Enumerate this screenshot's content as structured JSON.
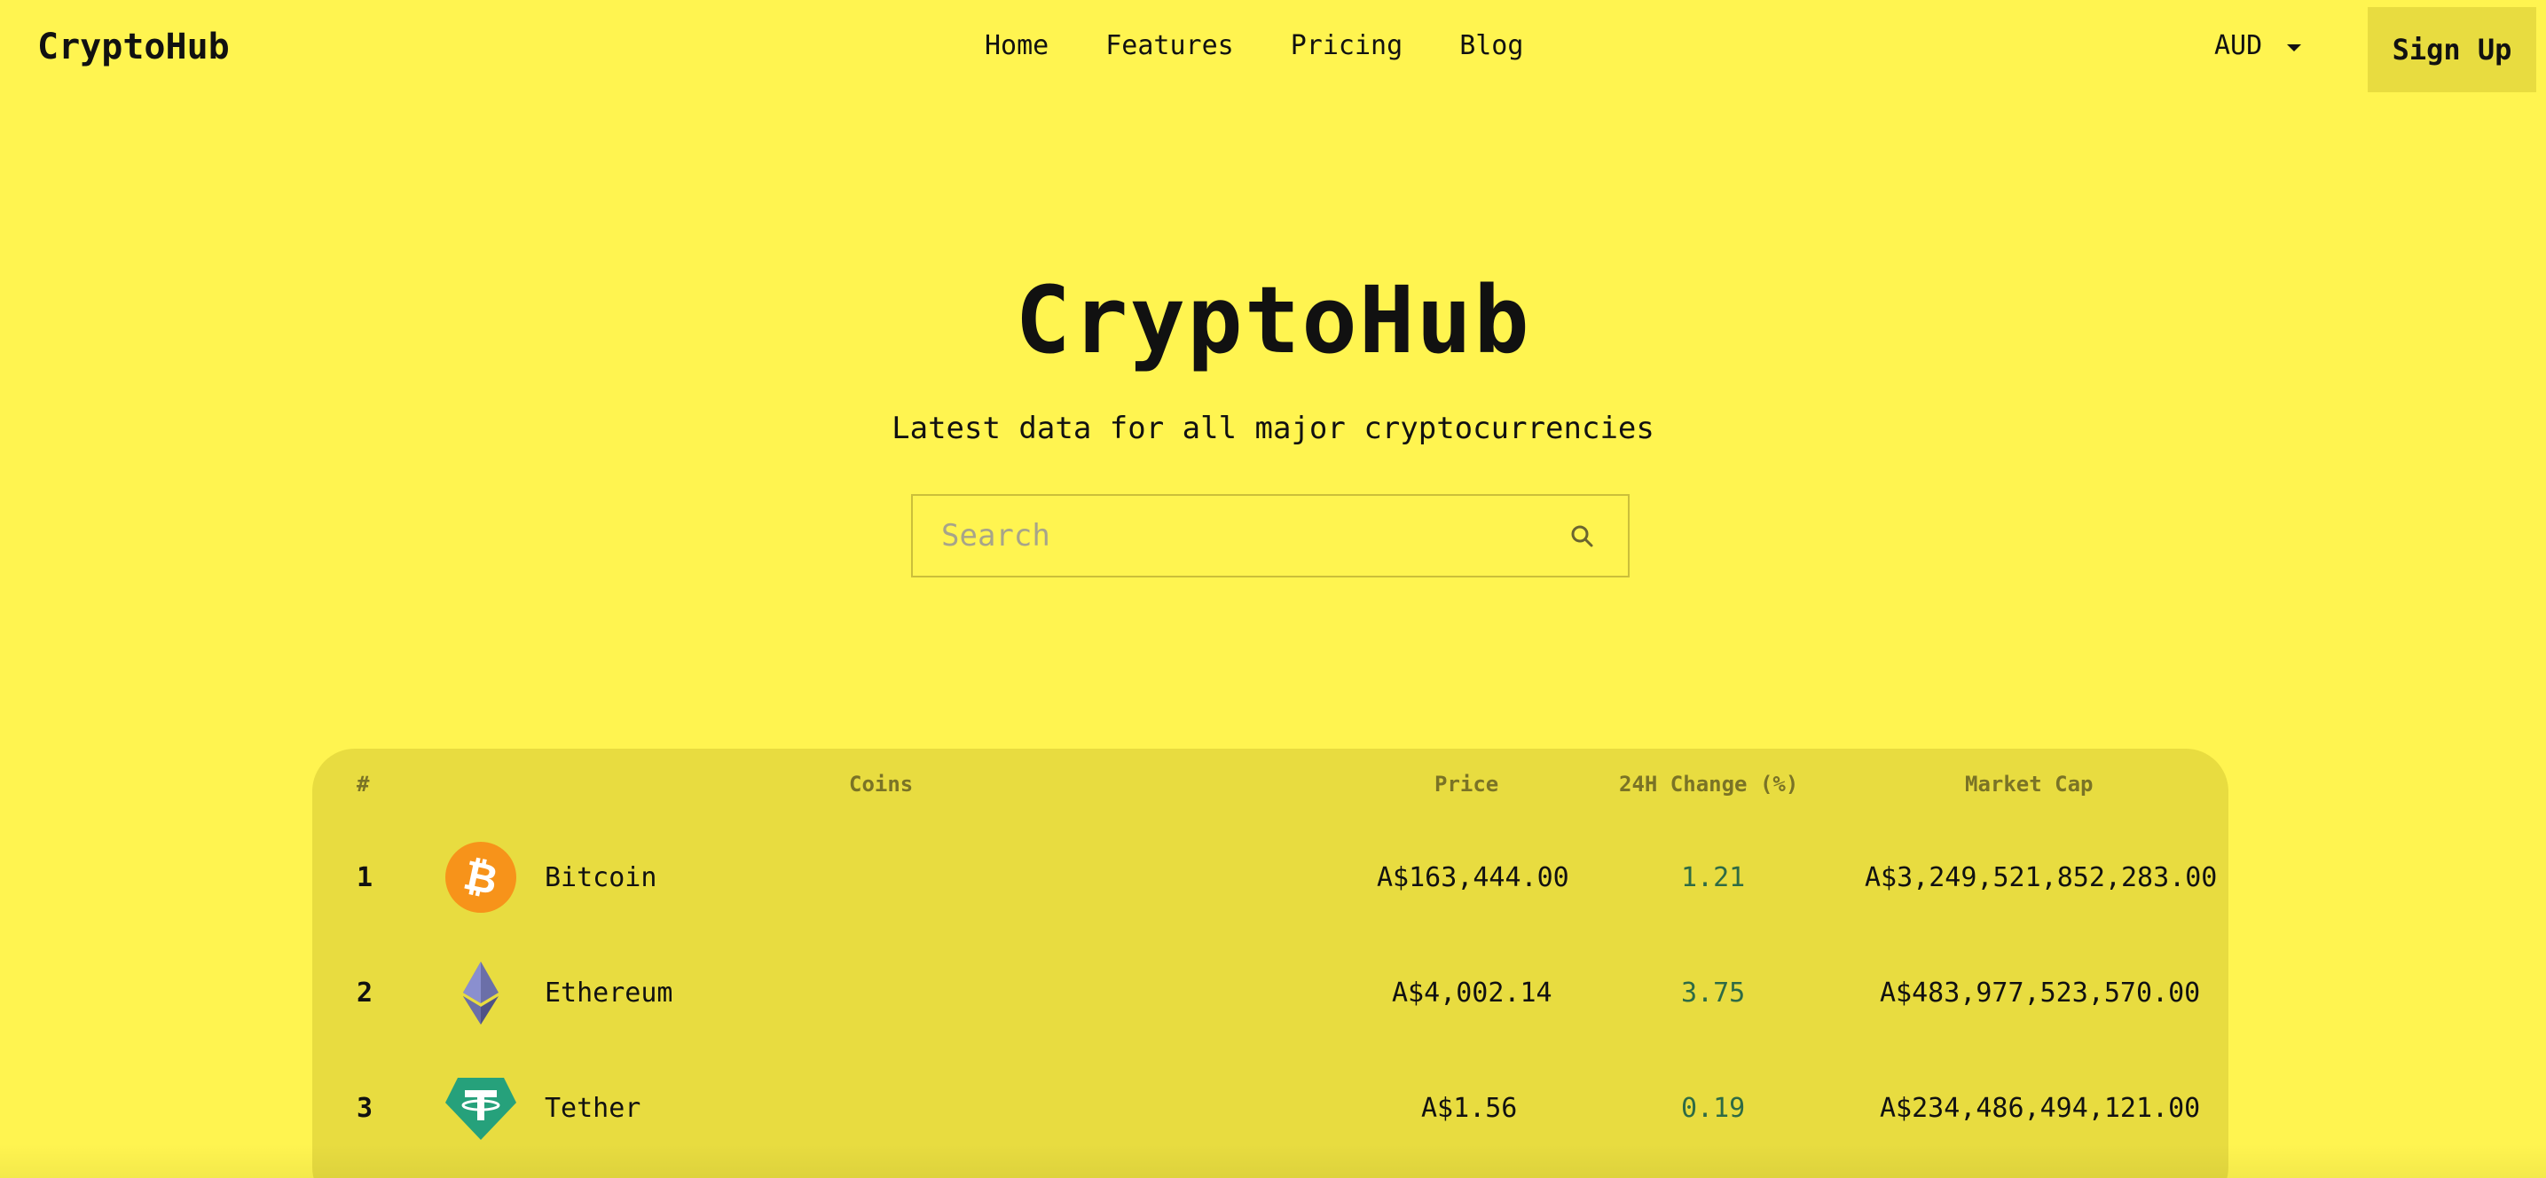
{
  "header": {
    "brand": "CryptoHub",
    "nav": [
      "Home",
      "Features",
      "Pricing",
      "Blog"
    ],
    "currency": "AUD",
    "signup_label": "Sign Up"
  },
  "hero": {
    "title": "CryptoHub",
    "subtitle": "Latest data for all major cryptocurrencies",
    "search_placeholder": "Search"
  },
  "table": {
    "headers": {
      "rank": "#",
      "coins": "Coins",
      "price": "Price",
      "change": "24H Change (%)",
      "market_cap": "Market Cap"
    },
    "rows": [
      {
        "rank": "1",
        "name": "Bitcoin",
        "price": "A$163,444.00",
        "change": "1.21",
        "market_cap": "A$3,249,521,852,283.00",
        "icon": "bitcoin-icon"
      },
      {
        "rank": "2",
        "name": "Ethereum",
        "price": "A$4,002.14",
        "change": "3.75",
        "market_cap": "A$483,977,523,570.00",
        "icon": "ethereum-icon"
      },
      {
        "rank": "3",
        "name": "Tether",
        "price": "A$1.56",
        "change": "0.19",
        "market_cap": "A$234,486,494,121.00",
        "icon": "tether-icon"
      }
    ]
  },
  "colors": {
    "background": "#fff450",
    "card": "#e8dc40",
    "positive_change": "#2e6b45",
    "bitcoin": "#f7931a",
    "tether": "#26a17b"
  }
}
